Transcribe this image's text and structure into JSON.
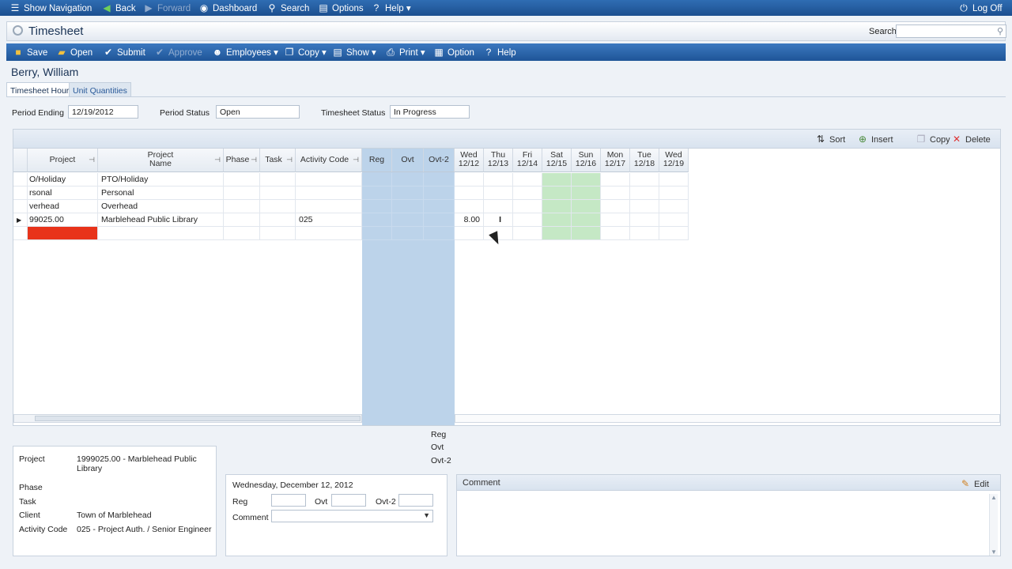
{
  "topnav": {
    "show_navigation": "Show Navigation",
    "back": "Back",
    "forward": "Forward",
    "dashboard": "Dashboard",
    "search": "Search",
    "options": "Options",
    "help": "Help",
    "logoff": "Log Off"
  },
  "title": {
    "text": "Timesheet",
    "search_label": "Search",
    "search_value": ""
  },
  "toolbar": {
    "save": "Save",
    "open": "Open",
    "submit": "Submit",
    "approve": "Approve",
    "employees": "Employees",
    "copy": "Copy",
    "show": "Show",
    "print": "Print",
    "option": "Option",
    "help": "Help"
  },
  "employee": {
    "name": "Berry, William"
  },
  "tabs": {
    "hours": "Timesheet Hours",
    "units": "Unit Quantities"
  },
  "period": {
    "ending_label": "Period Ending",
    "ending_value": "12/19/2012",
    "status_label": "Period Status",
    "status_value": "Open",
    "ts_status_label": "Timesheet Status",
    "ts_status_value": "In Progress"
  },
  "grid_toolbar": {
    "sort": "Sort",
    "insert": "Insert",
    "copy": "Copy",
    "delete": "Delete"
  },
  "grid": {
    "headers": {
      "project": "Project",
      "project_name_1": "Project",
      "project_name_2": "Name",
      "phase": "Phase",
      "task": "Task",
      "activity_code": "Activity Code",
      "reg": "Reg",
      "ovt": "Ovt",
      "ovt2": "Ovt-2"
    },
    "days": [
      {
        "dow": "Wed",
        "date": "12/12"
      },
      {
        "dow": "Thu",
        "date": "12/13"
      },
      {
        "dow": "Fri",
        "date": "12/14"
      },
      {
        "dow": "Sat",
        "date": "12/15"
      },
      {
        "dow": "Sun",
        "date": "12/16"
      },
      {
        "dow": "Mon",
        "date": "12/17"
      },
      {
        "dow": "Tue",
        "date": "12/18"
      },
      {
        "dow": "Wed",
        "date": "12/19"
      }
    ],
    "rows": [
      {
        "project": "O/Holiday",
        "name": "PTO/Holiday",
        "activity": "",
        "wed": ""
      },
      {
        "project": "rsonal",
        "name": "Personal",
        "activity": "",
        "wed": ""
      },
      {
        "project": "verhead",
        "name": "Overhead",
        "activity": "",
        "wed": ""
      },
      {
        "project": "99025.00",
        "name": "Marblehead Public Library",
        "activity": "025",
        "wed": "8.00"
      }
    ]
  },
  "detail": {
    "project_label": "Project",
    "project_value": "1999025.00 - Marblehead Public Library",
    "phase_label": "Phase",
    "task_label": "Task",
    "client_label": "Client",
    "client_value": "Town of Marblehead",
    "activity_label": "Activity Code",
    "activity_value": "025 - Project Auth. / Senior Engineer"
  },
  "legend": {
    "reg": "Reg",
    "ovt": "Ovt",
    "ovt2": "Ovt-2"
  },
  "day_entry": {
    "date": "Wednesday, December 12, 2012",
    "reg": "Reg",
    "ovt": "Ovt",
    "ovt2": "Ovt-2",
    "comment": "Comment"
  },
  "comment": {
    "title": "Comment",
    "edit": "Edit"
  },
  "colors": {
    "nav_blue": "#1f5597",
    "weekend_green": "#c5e8c5",
    "new_row_red": "#e8331a",
    "hours_shade": "#bcd3ea"
  }
}
